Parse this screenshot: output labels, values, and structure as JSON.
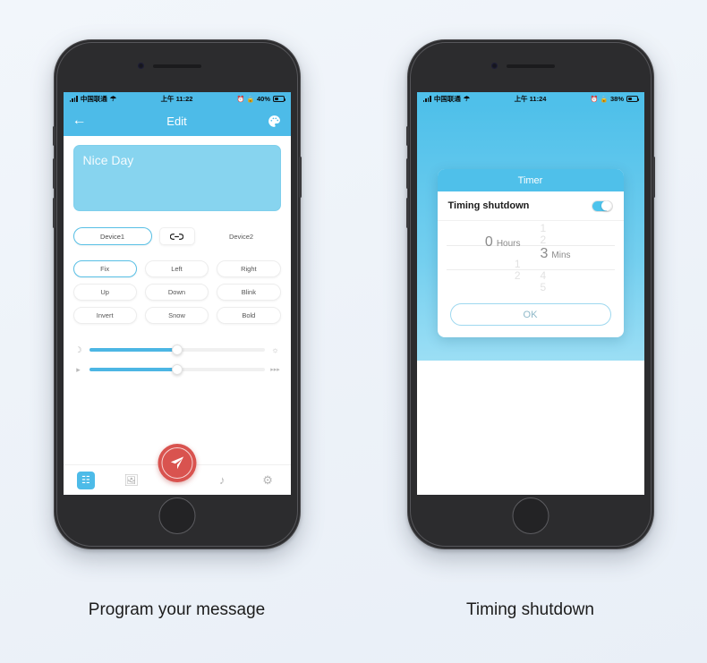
{
  "page": {
    "background_color": "#eef3f9"
  },
  "panels": [
    {
      "caption": "Program your message",
      "status_bar": {
        "carrier": "中国联通",
        "wifi_icon": "wifi-icon",
        "time": "上午 11:22",
        "alarm_icon": "alarm-icon",
        "lock_icon": "rotation-lock-icon",
        "battery_percent": "40%"
      },
      "navbar": {
        "back_icon": "back-arrow-icon",
        "title": "Edit",
        "action_icon": "palette-icon"
      },
      "message": {
        "text": "Nice Day",
        "placeholder": "Nice Day",
        "background_color": "#87d4ef"
      },
      "devices": {
        "device1": "Device1",
        "link_icon": "link-icon",
        "device2": "Device2",
        "selected": "Device1"
      },
      "effects": [
        {
          "label": "Fix",
          "active": true
        },
        {
          "label": "Left",
          "active": false
        },
        {
          "label": "Right",
          "active": false
        },
        {
          "label": "Up",
          "active": false
        },
        {
          "label": "Down",
          "active": false
        },
        {
          "label": "Blink",
          "active": false
        },
        {
          "label": "Invert",
          "active": false
        },
        {
          "label": "Snow",
          "active": false
        },
        {
          "label": "Bold",
          "active": false
        }
      ],
      "sliders": [
        {
          "name": "brightness",
          "left_icon": "moon-icon",
          "right_icon": "sun-icon",
          "value": 50
        },
        {
          "name": "speed",
          "left_icon": "play-icon",
          "right_icon": "fast-forward-icon",
          "value": 50
        }
      ],
      "tabbar": {
        "items": [
          {
            "icon": "text-document-icon",
            "active": true
          },
          {
            "icon": "image-icon",
            "active": false
          },
          {
            "icon": "music-note-icon",
            "active": false
          },
          {
            "icon": "gear-icon",
            "active": false
          }
        ],
        "send_icon": "send-paper-plane-icon",
        "send_color": "#d9534f"
      }
    },
    {
      "caption": "Timing shutdown",
      "status_bar": {
        "carrier": "中国联通",
        "wifi_icon": "wifi-icon",
        "time": "上午 11:24",
        "alarm_icon": "alarm-icon",
        "lock_icon": "rotation-lock-icon",
        "battery_percent": "38%"
      },
      "dialog": {
        "title": "Timer",
        "row_label": "Timing shutdown",
        "toggle_state": "on",
        "picker": {
          "hours_value": "0",
          "hours_unit": "Hours",
          "hours_above": [
            "",
            ""
          ],
          "hours_below": [
            "1",
            "2"
          ],
          "mins_value": "3",
          "mins_unit": "Mins",
          "mins_above": [
            "1",
            "2"
          ],
          "mins_below": [
            "4",
            "5"
          ]
        },
        "ok_label": "OK"
      },
      "theme_color": "#4fc0ea"
    }
  ]
}
